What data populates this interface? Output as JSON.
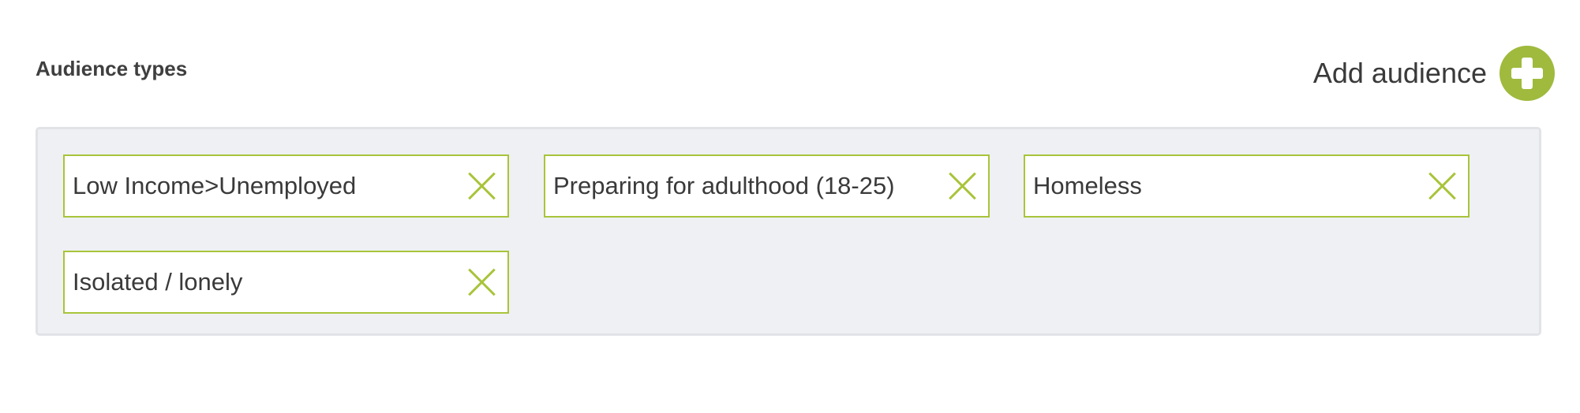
{
  "section": {
    "title": "Audience types"
  },
  "add_audience": {
    "label": "Add audience",
    "icon": "plus-circle-icon",
    "color": "#9fba3d"
  },
  "tags": [
    {
      "label": "Low Income>Unemployed",
      "remove_icon": "close-icon"
    },
    {
      "label": "Preparing for adulthood (18-25)",
      "remove_icon": "close-icon"
    },
    {
      "label": "Homeless",
      "remove_icon": "close-icon"
    },
    {
      "label": "Isolated / lonely",
      "remove_icon": "close-icon"
    }
  ],
  "colors": {
    "accent": "#a8c43a",
    "panel_background": "#eff0f3",
    "text": "#3a3a3a"
  }
}
